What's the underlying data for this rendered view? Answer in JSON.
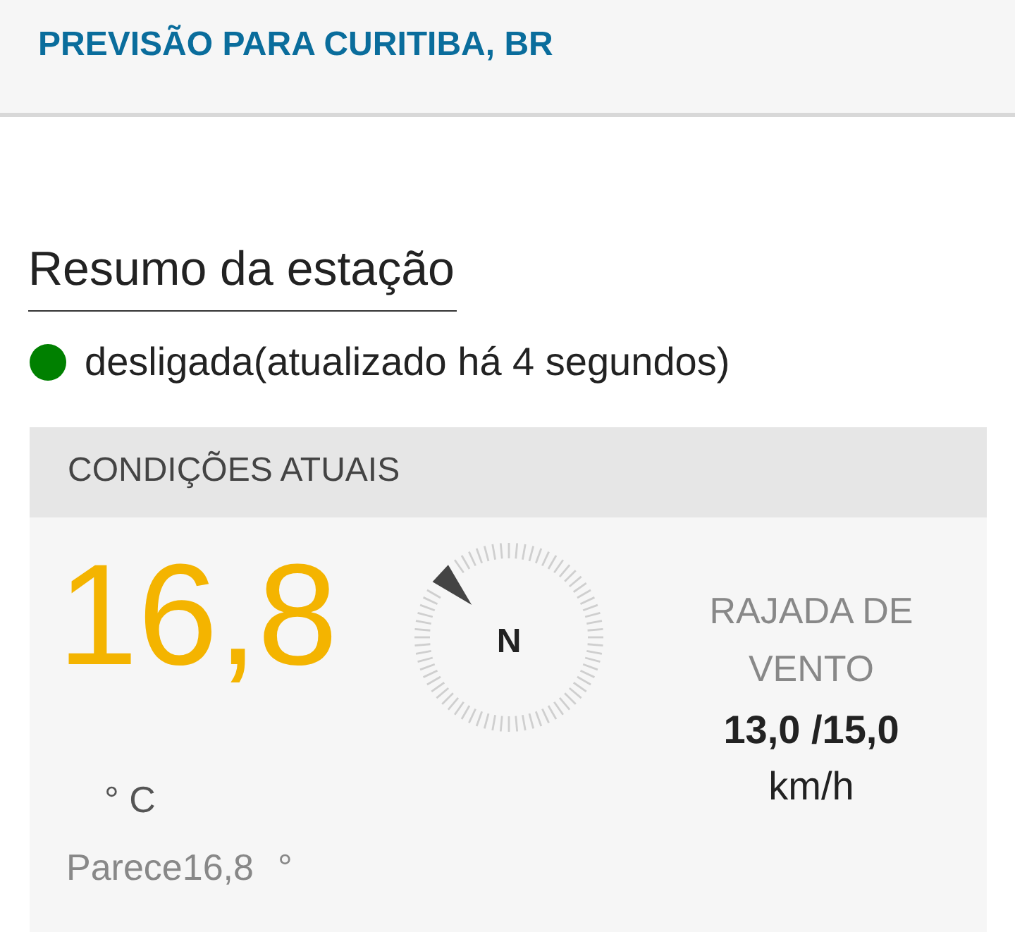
{
  "header": {
    "title": "PREVISÃO PARA CURITIBA, BR"
  },
  "station_summary": {
    "heading": "Resumo da estação",
    "status": {
      "color": "#008000",
      "text": "desligada(atualizado há 4 segundos)"
    }
  },
  "current_conditions": {
    "heading": "CONDIÇÕES ATUAIS",
    "temperature": {
      "value": "16,8",
      "unit": "° C"
    },
    "feels_like": {
      "text": "Parece16,8",
      "unit": "°"
    },
    "compass": {
      "label": "N"
    },
    "wind_gust": {
      "label": "RAJADA DE VENTO",
      "value": "13,0 /15,0",
      "unit": "km/h"
    }
  }
}
